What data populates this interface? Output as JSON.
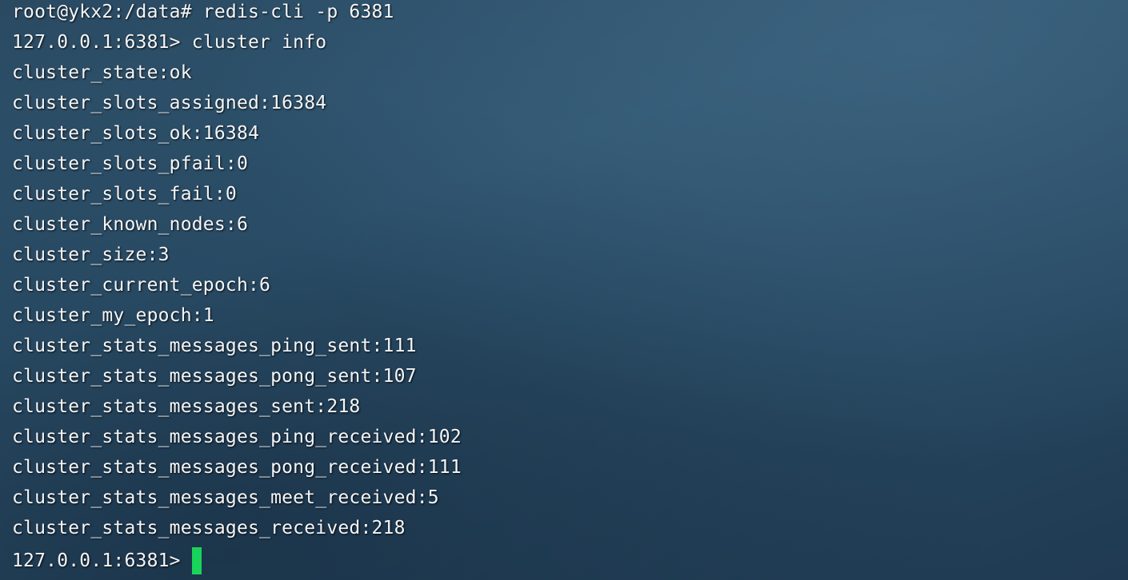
{
  "terminal": {
    "lines": [
      "root@ykx2:/data# redis-cli -p 6381",
      "127.0.0.1:6381> cluster info",
      "cluster_state:ok",
      "cluster_slots_assigned:16384",
      "cluster_slots_ok:16384",
      "cluster_slots_pfail:0",
      "cluster_slots_fail:0",
      "cluster_known_nodes:6",
      "cluster_size:3",
      "cluster_current_epoch:6",
      "cluster_my_epoch:1",
      "cluster_stats_messages_ping_sent:111",
      "cluster_stats_messages_pong_sent:107",
      "cluster_stats_messages_sent:218",
      "cluster_stats_messages_ping_received:102",
      "cluster_stats_messages_pong_received:111",
      "cluster_stats_messages_meet_received:5",
      "cluster_stats_messages_received:218"
    ],
    "current_prompt": "127.0.0.1:6381>",
    "cursor_color": "#19d45a"
  }
}
